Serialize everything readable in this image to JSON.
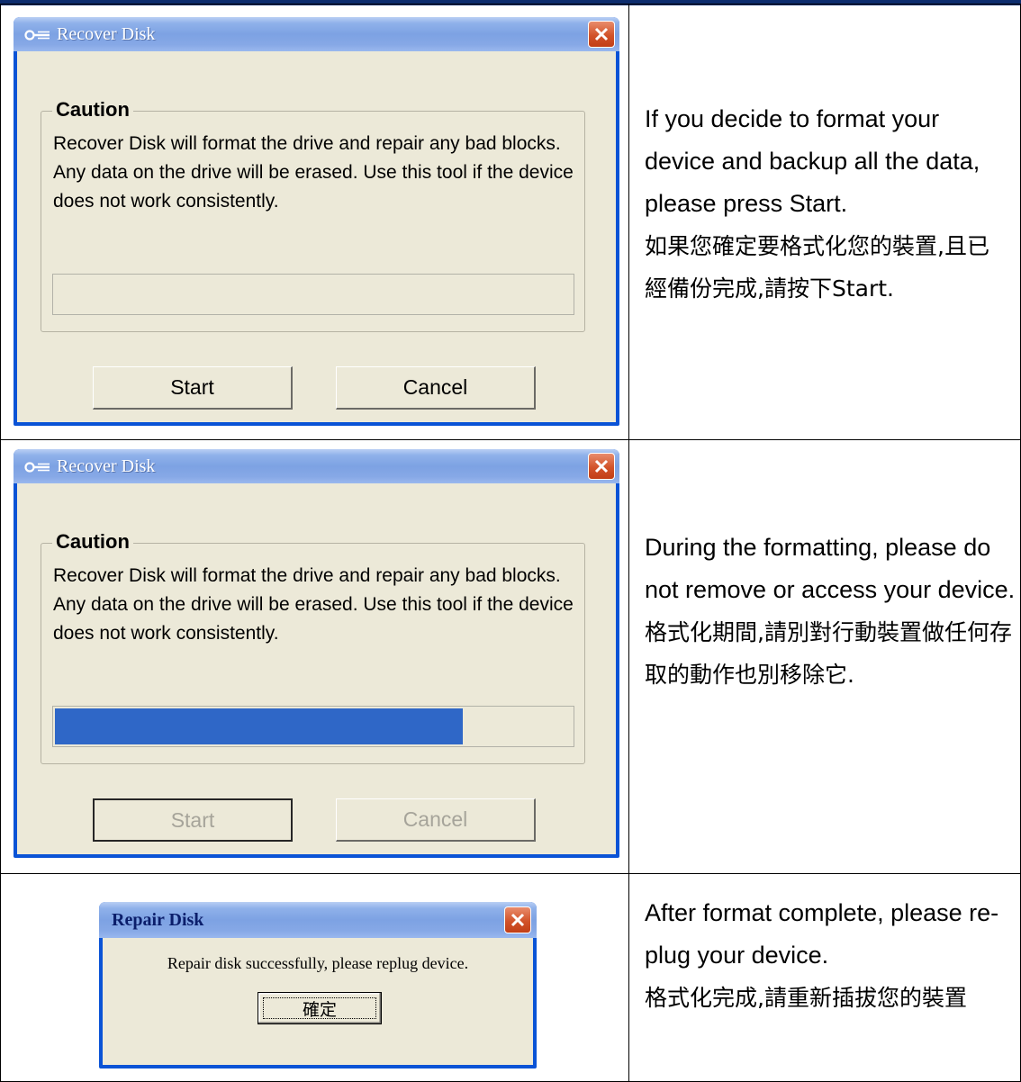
{
  "rows": [
    {
      "dialog": {
        "title": "Recover Disk",
        "group_title": "Caution",
        "message": "Recover Disk will format the drive and repair any bad blocks. Any data on the drive will be erased. Use this tool if the device does not work consistently.",
        "progress": 0,
        "start_label": "Start",
        "cancel_label": "Cancel"
      },
      "desc_en": "If you decide to format your device and backup all the data, please press Start.",
      "desc_zh": "如果您確定要格式化您的裝置,且已經備份完成,請按下Start."
    },
    {
      "dialog": {
        "title": "Recover Disk",
        "group_title": "Caution",
        "message": "Recover Disk will format the drive and repair any bad blocks. Any data on the drive will be erased. Use this tool if the device does not work consistently.",
        "progress": 0.79,
        "start_label": "Start",
        "cancel_label": "Cancel"
      },
      "desc_en": "During the formatting, please do not remove or access your device.",
      "desc_zh": "格式化期間,請別對行動裝置做任何存取的動作也別移除它."
    },
    {
      "dialog": {
        "title": "Repair Disk",
        "message": "Repair disk successfully, please replug device.",
        "ok_label": "確定"
      },
      "desc_en": "After format complete, please re-plug your device.",
      "desc_zh": "格式化完成,請重新插拔您的裝置"
    }
  ],
  "colors": {
    "window_frame": "#0a53d6",
    "dialog_face": "#ece9d8",
    "progress_fill": "#2f67c7",
    "close_button": "#d2532a"
  },
  "icons": [
    "key-icon",
    "close-icon"
  ]
}
